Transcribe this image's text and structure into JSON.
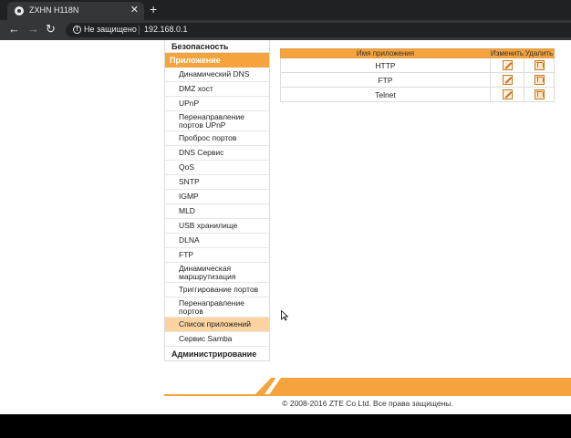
{
  "browser": {
    "tab_title": "ZXHN H118N",
    "tab_close": "✕",
    "new_tab": "+",
    "security_label": "Не защищено",
    "url": "192.168.0.1"
  },
  "sidebar": {
    "top_item": "Безопасность",
    "section": "Приложение",
    "items": [
      {
        "label": "Динамический DNS",
        "active": false
      },
      {
        "label": "DMZ хост",
        "active": false
      },
      {
        "label": "UPnP",
        "active": false
      },
      {
        "label": "Перенаправление портов UPnP",
        "active": false
      },
      {
        "label": "Проброс портов",
        "active": false
      },
      {
        "label": "DNS Сервис",
        "active": false
      },
      {
        "label": "QoS",
        "active": false
      },
      {
        "label": "SNTP",
        "active": false
      },
      {
        "label": "IGMP",
        "active": false
      },
      {
        "label": "MLD",
        "active": false
      },
      {
        "label": "USB хранилище",
        "active": false
      },
      {
        "label": "DLNA",
        "active": false
      },
      {
        "label": "FTP",
        "active": false
      },
      {
        "label": "Динамическая маршрутизация",
        "active": false
      },
      {
        "label": "Триггирование портов",
        "active": false
      },
      {
        "label": "Перенаправление портов",
        "active": false
      },
      {
        "label": "Список приложений",
        "active": true
      },
      {
        "label": "Сервис Samba",
        "active": false
      }
    ],
    "bottom_item": "Администрирование"
  },
  "app_table": {
    "headers": {
      "name": "Имя приложения",
      "edit": "Изменить",
      "delete": "Удалить"
    },
    "rows": [
      {
        "name": "HTTP",
        "edit_icon": "edit-icon",
        "delete_icon": "trash-icon"
      },
      {
        "name": "FTP",
        "edit_icon": "edit-icon",
        "delete_icon": "trash-icon"
      },
      {
        "name": "Telnet",
        "edit_icon": "edit-icon",
        "delete_icon": "trash-icon"
      }
    ]
  },
  "footer": {
    "copyright": "© 2008-2016 ZTE Co Ltd. Все права защищены."
  },
  "colors": {
    "accent": "#f5a33c",
    "active_item": "#fbd3a0"
  }
}
